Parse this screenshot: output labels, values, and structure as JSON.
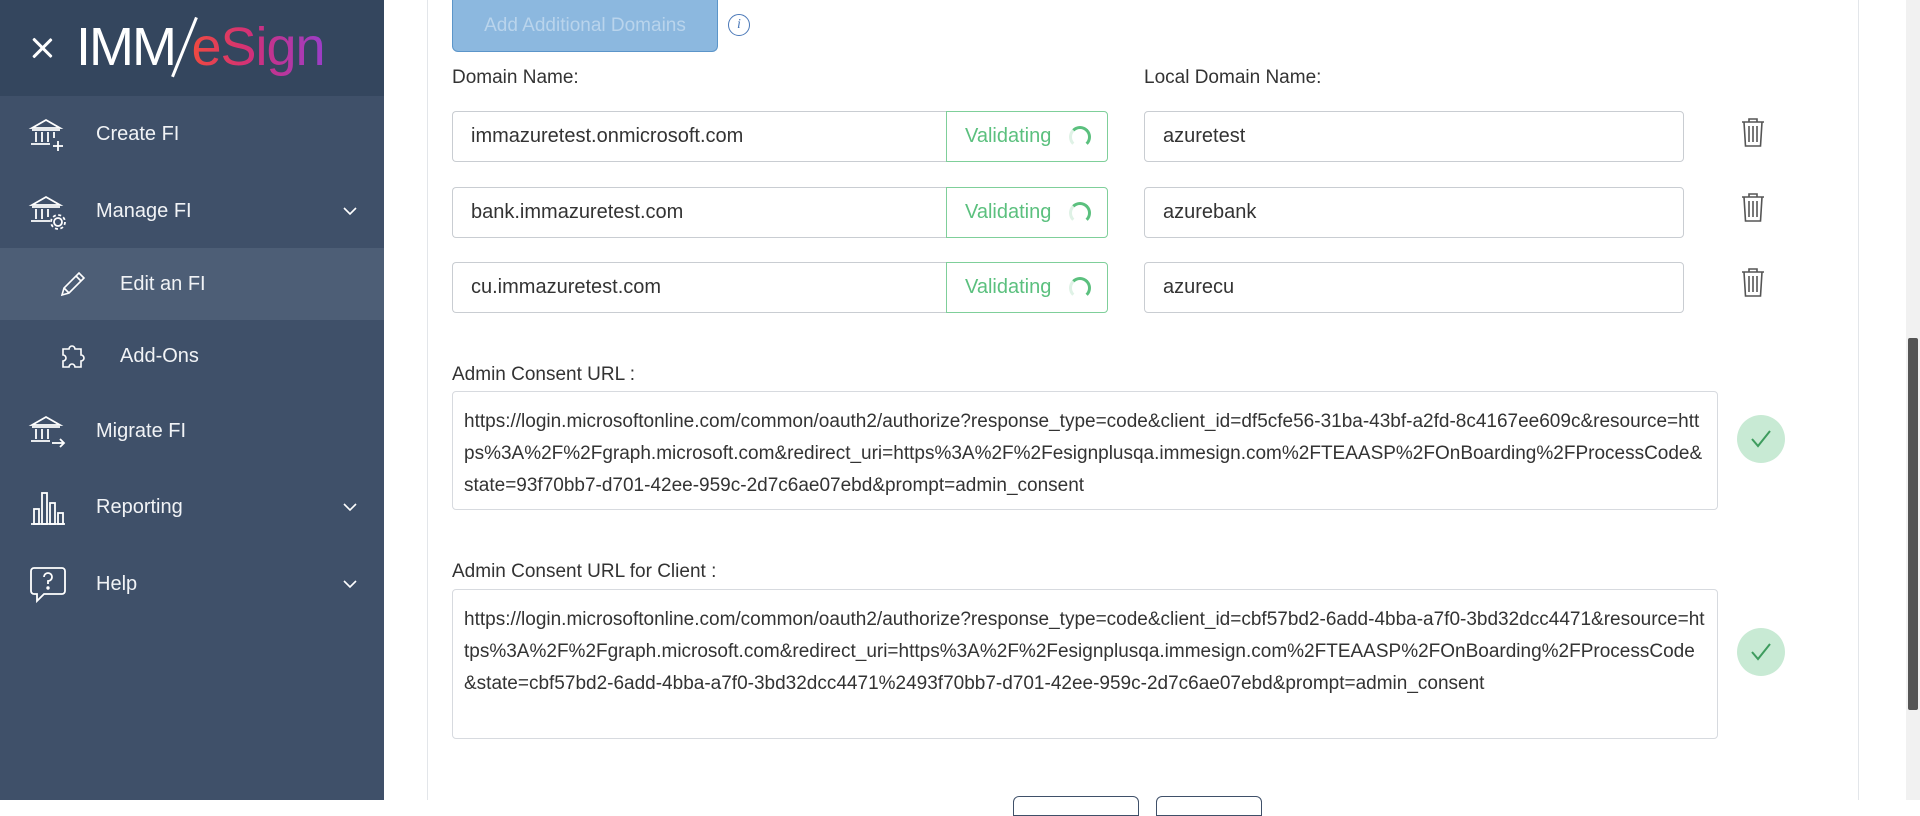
{
  "sidebar": {
    "logo": {
      "imm": "IMM",
      "esign": "eSign"
    },
    "items": [
      {
        "label": "Create FI",
        "icon": "bank-add-icon"
      },
      {
        "label": "Manage FI",
        "icon": "bank-settings-icon",
        "expanded": true
      },
      {
        "label": "Edit an FI",
        "icon": "pencil-icon",
        "active": true
      },
      {
        "label": "Add-Ons",
        "icon": "puzzle-icon"
      },
      {
        "label": "Migrate FI",
        "icon": "bank-migrate-icon"
      },
      {
        "label": "Reporting",
        "icon": "bar-chart-icon",
        "expanded": false
      },
      {
        "label": "Help",
        "icon": "help-bubble-icon",
        "expanded": false
      }
    ]
  },
  "main": {
    "add_domains_label": "Add Additional Domains",
    "info_glyph": "i",
    "domain_name_label": "Domain Name:",
    "local_domain_name_label": "Local Domain Name:",
    "domains": [
      {
        "domain": "immazuretest.onmicrosoft.com",
        "status": "Validating",
        "local": "azuretest"
      },
      {
        "domain": "bank.immazuretest.com",
        "status": "Validating",
        "local": "azurebank"
      },
      {
        "domain": "cu.immazuretest.com",
        "status": "Validating",
        "local": "azurecu"
      }
    ],
    "admin_consent_label": "Admin Consent URL :",
    "admin_consent_url": "https://login.microsoftonline.com/common/oauth2/authorize?response_type=code&client_id=df5cfe56-31ba-43bf-a2fd-8c4167ee609c&resource=https%3A%2F%2Fgraph.microsoft.com&redirect_uri=https%3A%2F%2Fesignplusqa.immesign.com%2FTEAASP%2FOnBoarding%2FProcessCode&state=93f70bb7-d701-42ee-959c-2d7c6ae07ebd&prompt=admin_consent",
    "admin_consent_client_label": "Admin Consent URL for Client :",
    "admin_consent_client_url": "https://login.microsoftonline.com/common/oauth2/authorize?response_type=code&client_id=cbf57bd2-6add-4bba-a7f0-3bd32dcc4471&resource=https%3A%2F%2Fgraph.microsoft.com&redirect_uri=https%3A%2F%2Fesignplusqa.immesign.com%2FTEAASP%2FOnBoarding%2FProcessCode&state=cbf57bd2-6add-4bba-a7f0-3bd32dcc4471%2493f70bb7-d701-42ee-959c-2d7c6ae07ebd&prompt=admin_consent"
  },
  "colors": {
    "sidebar_bg": "#3f5069",
    "sidebar_header_bg": "#34465e",
    "sidebar_active_bg": "#4d5e76",
    "validating_green": "#5bc07e",
    "button_blue": "#8cb8df"
  }
}
